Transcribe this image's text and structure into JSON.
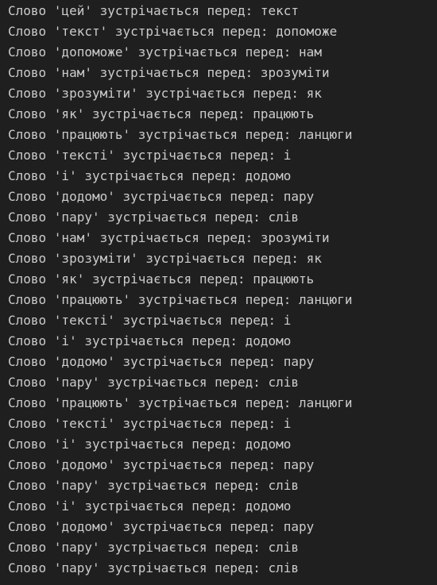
{
  "theme": {
    "background": "#1f1f1f",
    "text": "#cccccc"
  },
  "output_lines": [
    "Слово 'цей' зустрічається перед: текст",
    "Слово 'текст' зустрічається перед: допоможе",
    "Слово 'допоможе' зустрічається перед: нам",
    "Слово 'нам' зустрічається перед: зрозуміти",
    "Слово 'зрозуміти' зустрічається перед: як",
    "Слово 'як' зустрічається перед: працюють",
    "Слово 'працюють' зустрічається перед: ланцюги",
    "Слово 'тексті' зустрічається перед: і",
    "Слово 'і' зустрічається перед: додомо",
    "Слово 'додомо' зустрічається перед: пару",
    "Слово 'пару' зустрічається перед: слів",
    "Слово 'нам' зустрічається перед: зрозуміти",
    "Слово 'зрозуміти' зустрічається перед: як",
    "Слово 'як' зустрічається перед: працюють",
    "Слово 'працюють' зустрічається перед: ланцюги",
    "Слово 'тексті' зустрічається перед: і",
    "Слово 'і' зустрічається перед: додомо",
    "Слово 'додомо' зустрічається перед: пару",
    "Слово 'пару' зустрічається перед: слів",
    "Слово 'працюють' зустрічається перед: ланцюги",
    "Слово 'тексті' зустрічається перед: і",
    "Слово 'і' зустрічається перед: додомо",
    "Слово 'додомо' зустрічається перед: пару",
    "Слово 'пару' зустрічається перед: слів",
    "Слово 'і' зустрічається перед: додомо",
    "Слово 'додомо' зустрічається перед: пару",
    "Слово 'пару' зустрічається перед: слів",
    "Слово 'пару' зустрічається перед: слів"
  ]
}
